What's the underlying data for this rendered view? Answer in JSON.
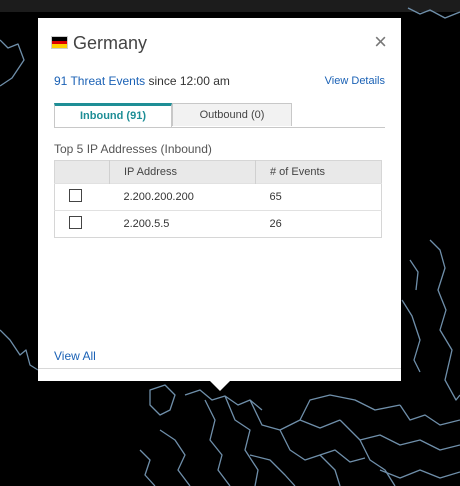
{
  "popup": {
    "country": "Germany",
    "flag_colors": [
      "#000000",
      "#dd0000",
      "#ffce00"
    ],
    "threat_events_link": "91 Threat Events",
    "summary_suffix": " since 12:00 am",
    "view_details": "View Details",
    "close_icon": "×",
    "tabs": [
      {
        "label": "Inbound (91)",
        "active": true
      },
      {
        "label": "Outbound (0)",
        "active": false
      }
    ],
    "section_title": "Top 5 IP Addresses (Inbound)",
    "table": {
      "headers": [
        "",
        "IP Address",
        "# of Events"
      ],
      "rows": [
        {
          "ip": "2.200.200.200",
          "events": "65"
        },
        {
          "ip": "2.200.5.5",
          "events": "26"
        }
      ]
    },
    "view_all": "View All"
  },
  "colors": {
    "accent": "#1e8e96",
    "link": "#1a61b5",
    "map_line": "#6f8faa",
    "background": "#000000"
  }
}
